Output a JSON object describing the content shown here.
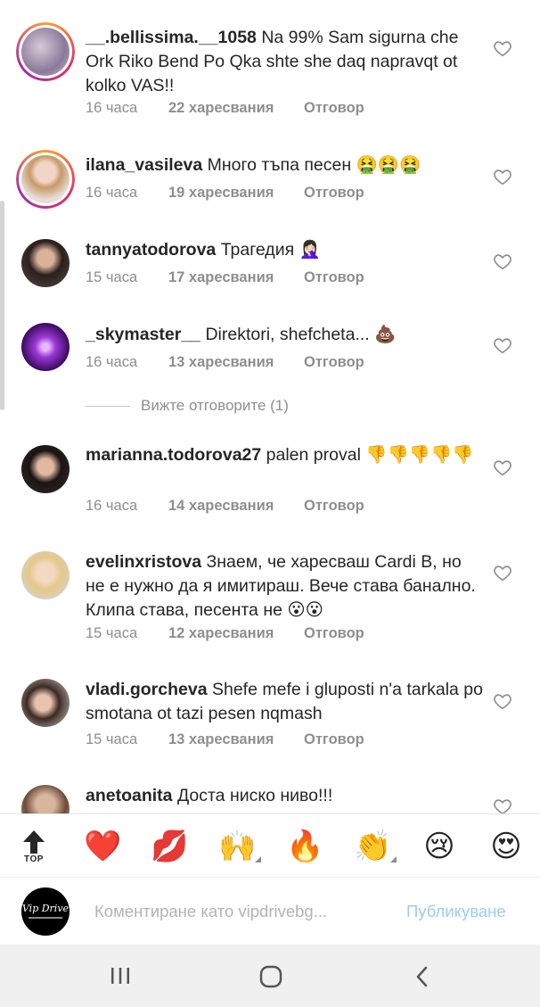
{
  "comments": [
    {
      "username": "__.bellissima.__1058",
      "text": "Na 99% Sam sigurna che Ork Riko Bend Po Qka shte she daq napravqt ot kolko VAS!!",
      "time": "16 часа",
      "likes": "22 харесвания",
      "reply": "Отговор"
    },
    {
      "username": "ilana_vasileva",
      "text": "Много тъпа песен 🤮🤮🤮",
      "time": "16 часа",
      "likes": "19 харесвания",
      "reply": "Отговор"
    },
    {
      "username": "tannyatodorova",
      "text": "Трагедия 🤦🏻‍♀️",
      "time": "15 часа",
      "likes": "17 харесвания",
      "reply": "Отговор"
    },
    {
      "username": "_skymaster__",
      "text": "Direktori, shefcheta... 💩",
      "time": "16 часа",
      "likes": "13 харесвания",
      "reply": "Отговор"
    },
    {
      "username": "marianna.todorova27",
      "text": "palen proval 👎👎👎👎👎",
      "time": "16 часа",
      "likes": "14 харесвания",
      "reply": "Отговор"
    },
    {
      "username": "evelinxristova",
      "text": "Знаем, че харесваш Cardi B, но не е нужно да я имитираш. Вече става банално. Клипа става, песента не 😮😮",
      "time": "15 часа",
      "likes": "12 харесвания",
      "reply": "Отговор"
    },
    {
      "username": "vladi.gorcheva",
      "text": "Shefe mefe i gluposti n'a tarkala po smotana ot tazi pesen nqmash",
      "time": "15 часа",
      "likes": "13 харесвания",
      "reply": "Отговор"
    },
    {
      "username": "anetoanita",
      "text": "Доста ниско ниво!!!",
      "time": "",
      "likes": "",
      "reply": ""
    }
  ],
  "view_replies": "Вижте отговорите (1)",
  "emoji_bar": {
    "top_label": "TOP",
    "emojis": [
      "❤️",
      "💋",
      "🙌",
      "🔥",
      "👏",
      "😢",
      "😍"
    ]
  },
  "composer": {
    "avatar_text": "Vip Drive",
    "placeholder": "Коментиране като vipdrivebg...",
    "post_label": "Публикуване"
  },
  "colors": {
    "text": "#262626",
    "meta": "#8e8e8e",
    "post_disabled": "#9ccbf5",
    "nav_bg": "#f0f0f0"
  },
  "icons": [
    "heart-icon",
    "top-arrow-icon",
    "recent-apps-icon",
    "home-icon",
    "back-icon"
  ]
}
